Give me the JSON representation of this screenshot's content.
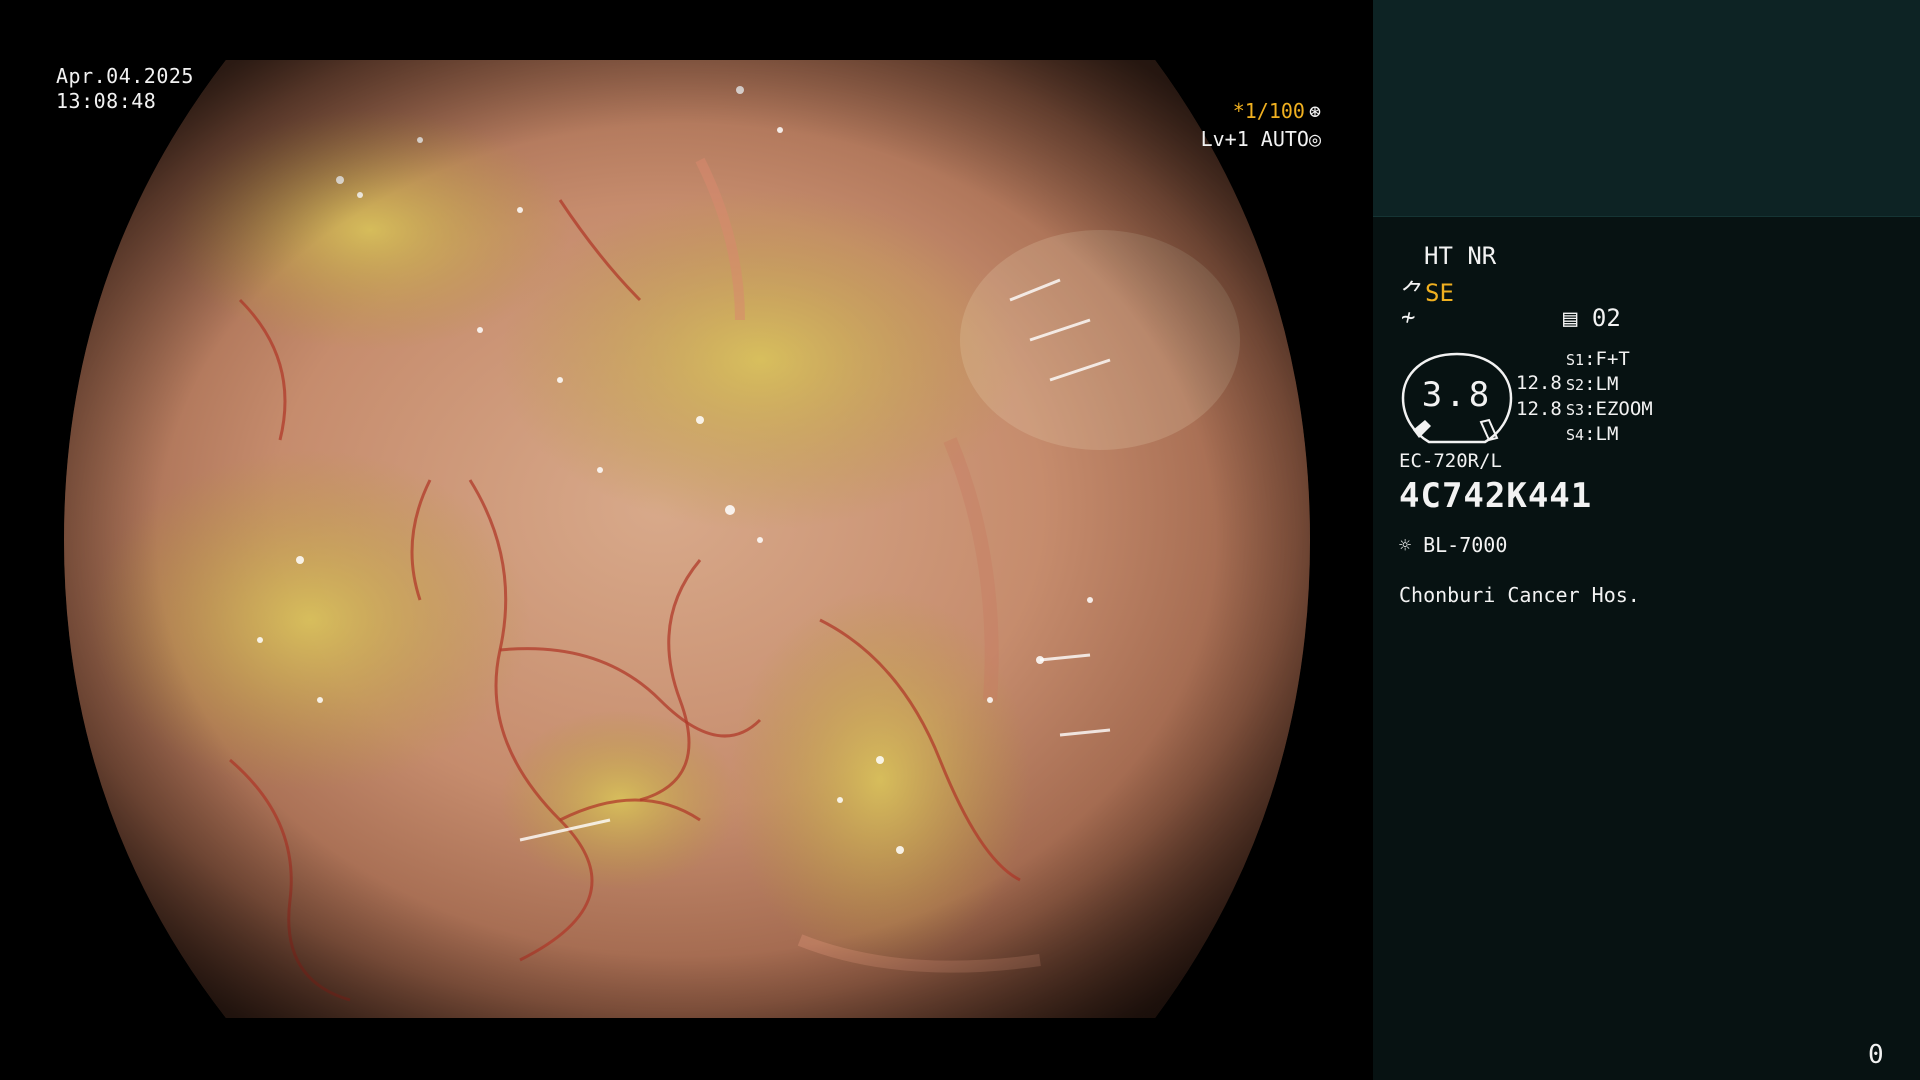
{
  "overlay": {
    "date": "Apr.04.2025",
    "time": "13:08:48",
    "shutter": "*1/100",
    "shutter_icon": "aperture-icon",
    "level": "Lv+1 AUTO",
    "level_icon": "iris-icon"
  },
  "panel": {
    "ht_nr": "HT NR",
    "se_label": "SE",
    "se_icon": "scope-symbol-icon",
    "enhance_icon": "enhance-slash-icon",
    "memory_value": "02",
    "gauge_value": "3.8",
    "gauge_side_1": "12.8",
    "gauge_side_2": "12.8",
    "switches": [
      {
        "key": "S1",
        "value": "F+T"
      },
      {
        "key": "S2",
        "value": "LM"
      },
      {
        "key": "S3",
        "value": "EZOOM"
      },
      {
        "key": "S4",
        "value": "LM"
      }
    ],
    "scope_model": "EC-720R/L",
    "scope_serial": "4C742K441",
    "light_source": "BL-7000",
    "hospital": "Chonburi Cancer Hos.",
    "counter": "0"
  },
  "colors": {
    "panel_bg": "#071212",
    "panel_top_bg": "#0d2324",
    "accent": "#f0b020",
    "text": "#f2f2f2"
  }
}
